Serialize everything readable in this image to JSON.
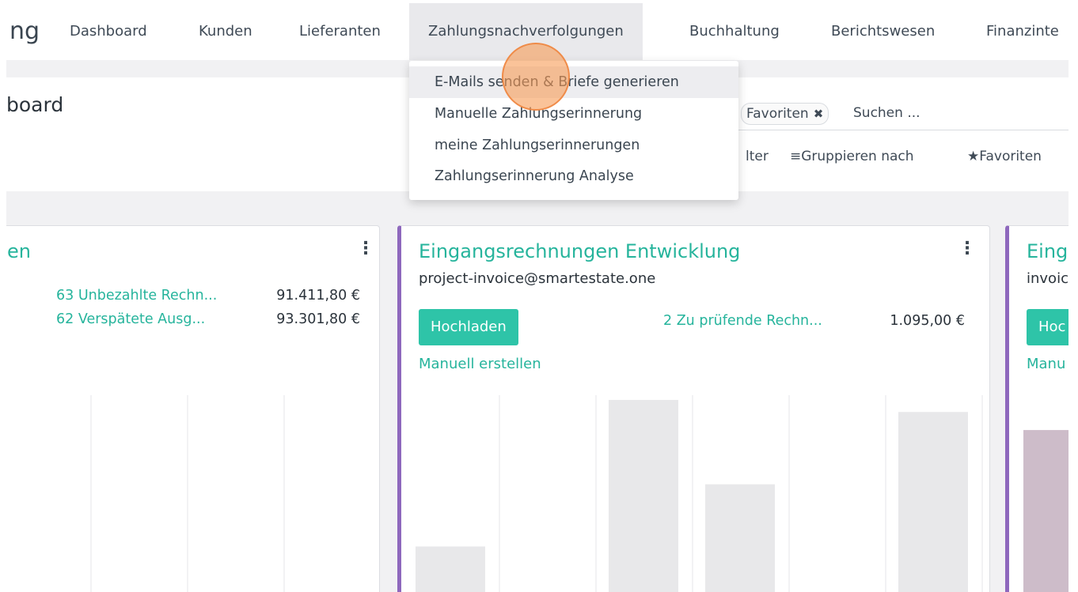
{
  "navbar": {
    "brand": "ng",
    "items": [
      {
        "label": "Dashboard"
      },
      {
        "label": "Kunden"
      },
      {
        "label": "Lieferanten"
      },
      {
        "label": "Zahlungsnachverfolgungen"
      },
      {
        "label": "Buchhaltung"
      },
      {
        "label": "Berichtswesen"
      },
      {
        "label": "Finanzinte"
      }
    ]
  },
  "dropdown": {
    "items": [
      {
        "label": "E-Mails senden & Briefe generieren"
      },
      {
        "label": "Manuelle Zahlungserinnerung"
      },
      {
        "label": "meine Zahlungserinnerungen"
      },
      {
        "label": "Zahlungserinnerung Analyse"
      }
    ]
  },
  "control_panel": {
    "title": "board",
    "facet_label": "Favoriten",
    "search_placeholder": "Suchen ...",
    "filter_label": "lter",
    "group_by_label": "Gruppieren nach",
    "favorites_label": "Favoriten"
  },
  "cards": {
    "left": {
      "title": "en",
      "stats": [
        {
          "label": "63 Unbezahlte Rechn...",
          "value": "91.411,80 €"
        },
        {
          "label": "62 Verspätete Ausg...",
          "value": "93.301,80 €"
        }
      ]
    },
    "middle": {
      "title": "Eingangsrechnungen Entwicklung",
      "email": "project-invoice@smartestate.one",
      "upload_label": "Hochladen",
      "manual_label": "Manuell erstellen",
      "stat_label": "2 Zu prüfende Rechn...",
      "stat_value": "1.095,00 €"
    },
    "right": {
      "title": "Eing",
      "email": "invoic",
      "upload_label": "Hoc",
      "manual_label": "Manu"
    }
  },
  "colors": {
    "accent": "#26b49c",
    "button": "#2ec4a8",
    "card_border": "#8e68bd",
    "cursor": "#f69b55"
  },
  "chart_data": [
    {
      "type": "bar",
      "bars": [
        {
          "fill": 0.0
        },
        {
          "fill": 0.0
        },
        {
          "fill": 0.0
        },
        {
          "fill": 0.0
        }
      ]
    },
    {
      "type": "bar",
      "bars": [
        {
          "fill": 0.27
        },
        {
          "fill": 0.0
        },
        {
          "fill": 1.0
        },
        {
          "fill": 0.58
        },
        {
          "fill": 0.03
        },
        {
          "fill": 0.94
        }
      ]
    },
    {
      "type": "bar",
      "bars": [
        {
          "fill": 0.85
        }
      ]
    }
  ]
}
